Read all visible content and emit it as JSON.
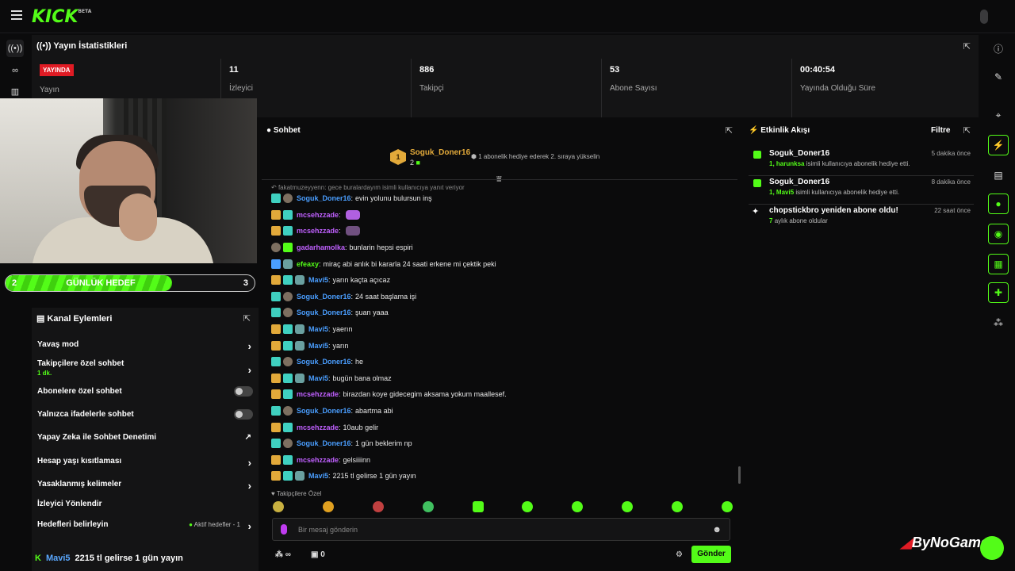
{
  "app": {
    "logo": "KICK",
    "logo_sup": "BETA"
  },
  "stats": {
    "title": "Yayın İstatistikleri",
    "live_badge": "YAYINDA",
    "items": [
      {
        "value": "",
        "label": "Yayın"
      },
      {
        "value": "11",
        "label": "İzleyici"
      },
      {
        "value": "886",
        "label": "Takipçi"
      },
      {
        "value": "53",
        "label": "Abone Sayısı"
      },
      {
        "value": "00:40:54",
        "label": "Yayında Olduğu Süre"
      }
    ]
  },
  "goal": {
    "current": "2",
    "label": "GÜNLÜK HEDEF",
    "target": "3",
    "progress": 0.67
  },
  "actions": {
    "title": "Kanal Eylemleri",
    "items": [
      {
        "label": "Yavaş mod"
      },
      {
        "label": "Takipçilere özel sohbet",
        "sub": "1 dk."
      },
      {
        "label": "Abonelere özel sohbet"
      },
      {
        "label": "Yalnızca ifadelerle sohbet"
      },
      {
        "label": "Yapay Zeka ile Sohbet Denetimi"
      },
      {
        "label": "Hesap yaşı kısıtlaması"
      },
      {
        "label": "Yasaklanmış kelimeler"
      },
      {
        "label": "İzleyici Yönlendir"
      },
      {
        "label": "Hedefleri belirleyin",
        "status": "Aktif hedefler - 1"
      }
    ]
  },
  "pinned": {
    "user": "Mavi5",
    "text": "2215 tl gelirse 1 gün yayın"
  },
  "chat": {
    "title": "Sohbet",
    "top_sub": {
      "rank": "1",
      "name": "Soguk_Doner16",
      "count": "2",
      "message": "1 abonelik hediye ederek 2. sıraya yükselin"
    },
    "reply_hint": "fakatmuzeyyenn: gece buralardayım isimli kullanıcıya yanıt veriyor",
    "messages": [
      {
        "user": "Soguk_Doner16",
        "color": "#4a9eff",
        "text": "evin yolunu bulursun inş"
      },
      {
        "user": "mcsehzzade",
        "color": "#c060ff",
        "text": ""
      },
      {
        "user": "mcsehzzade",
        "color": "#c060ff",
        "text": ""
      },
      {
        "user": "gadarhamolka",
        "color": "#c060ff",
        "text": "bunlarin hepsi espiri"
      },
      {
        "user": "efeaxy",
        "color": "#53fc18",
        "text": "miraç abi anlık bi kararla 24 saati erkene mi çektik peki"
      },
      {
        "user": "Mavi5",
        "color": "#4a9eff",
        "text": "yarın kaçta açıcaz"
      },
      {
        "user": "Soguk_Doner16",
        "color": "#4a9eff",
        "text": "24 saat başlama işi"
      },
      {
        "user": "Soguk_Doner16",
        "color": "#4a9eff",
        "text": "şuan yaaa"
      },
      {
        "user": "Mavi5",
        "color": "#4a9eff",
        "text": "yaerın"
      },
      {
        "user": "Mavi5",
        "color": "#4a9eff",
        "text": "yarın"
      },
      {
        "user": "Soguk_Doner16",
        "color": "#4a9eff",
        "text": "he"
      },
      {
        "user": "Mavi5",
        "color": "#4a9eff",
        "text": "bugün bana olmaz"
      },
      {
        "user": "mcsehzzade",
        "color": "#c060ff",
        "text": "birazdan koye gidecegim aksama yokum maallesef."
      },
      {
        "user": "Soguk_Doner16",
        "color": "#4a9eff",
        "text": "abartma abi"
      },
      {
        "user": "mcsehzzade",
        "color": "#c060ff",
        "text": "10aub gelir"
      },
      {
        "user": "Soguk_Doner16",
        "color": "#4a9eff",
        "text": "1 gün beklerim np"
      },
      {
        "user": "mcsehzzade",
        "color": "#c060ff",
        "text": "gelsiiiinn"
      },
      {
        "user": "Mavi5",
        "color": "#4a9eff",
        "text": "2215 tl gelirse 1 gün yayın"
      }
    ],
    "followers_only": "Takipçilere Özel",
    "placeholder": "Bir mesaj gönderin",
    "infinity": "∞",
    "gift_count": "0",
    "send": "Gönder"
  },
  "events": {
    "title": "Etkinlik Akışı",
    "filter": "Filtre",
    "items": [
      {
        "name": "Soguk_Doner16",
        "time": "5 dakika önce",
        "count": "1,",
        "target": "harunksa",
        "desc": "isimli kullanıcıya abonelik hediye etti."
      },
      {
        "name": "Soguk_Doner16",
        "time": "8 dakika önce",
        "count": "1,",
        "target": "Mavi5",
        "desc": "isimli kullanıcıya abonelik hediye etti."
      },
      {
        "name": "chopstickbro yeniden abone oldu!",
        "time": "22 saat önce",
        "count": "7",
        "target": "",
        "desc": "aylık abone oldular"
      }
    ]
  },
  "watermark": "ByNoGame"
}
